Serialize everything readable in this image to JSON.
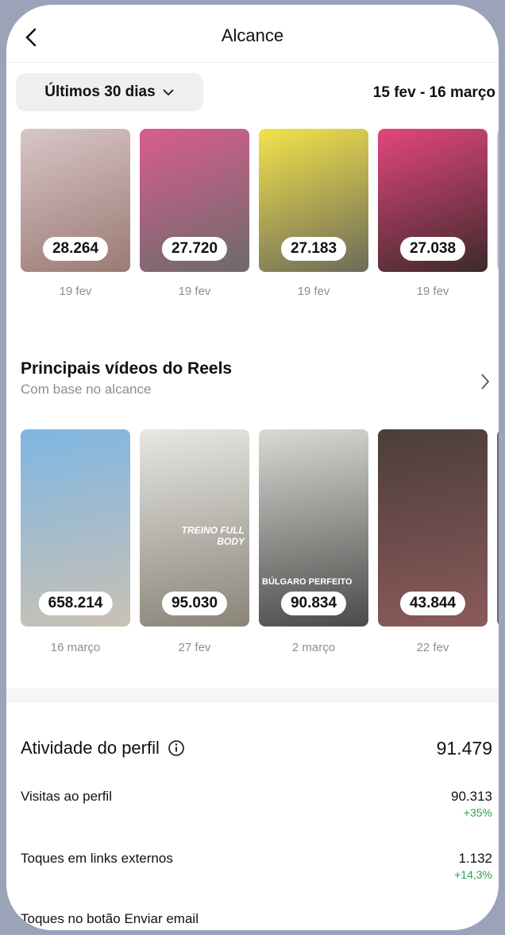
{
  "header": {
    "title": "Alcance"
  },
  "filter": {
    "range_label": "Últimos 30 dias",
    "dates": "15 fev - 16 março"
  },
  "top_posts": [
    {
      "value": "28.264",
      "date": "19 fev",
      "colors": [
        "#d8c6c8",
        "#9b7a73"
      ]
    },
    {
      "value": "27.720",
      "date": "19 fev",
      "colors": [
        "#d95d8e",
        "#6b6b6b"
      ]
    },
    {
      "value": "27.183",
      "date": "19 fev",
      "colors": [
        "#f3e34a",
        "#6c6a5a"
      ]
    },
    {
      "value": "27.038",
      "date": "19 fev",
      "colors": [
        "#e3467e",
        "#3c2a2a"
      ]
    }
  ],
  "reels": {
    "title": "Principais vídeos do Reels",
    "subtitle": "Com base no alcance",
    "items": [
      {
        "value": "658.214",
        "date": "16 março",
        "colors": [
          "#7fb6e2",
          "#c9c1b5"
        ]
      },
      {
        "value": "95.030",
        "date": "27 fev",
        "colors": [
          "#e7e7e4",
          "#8a8478"
        ],
        "caption": "TREINO FULL BODY"
      },
      {
        "value": "90.834",
        "date": "2 março",
        "colors": [
          "#d9d9d6",
          "#4a4a48"
        ],
        "caption": "BÚLGARO PERFEITO"
      },
      {
        "value": "43.844",
        "date": "22 fev",
        "colors": [
          "#4b3e3b",
          "#8b5a5a"
        ]
      }
    ]
  },
  "activity": {
    "title": "Atividade do perfil",
    "total": "91.479",
    "rows": [
      {
        "label": "Visitas ao perfil",
        "value": "90.313",
        "change": "+35%"
      },
      {
        "label": "Toques em links externos",
        "value": "1.132",
        "change": "+14,3%"
      },
      {
        "label": "Toques no botão Enviar email",
        "value": "",
        "change": ""
      }
    ]
  }
}
